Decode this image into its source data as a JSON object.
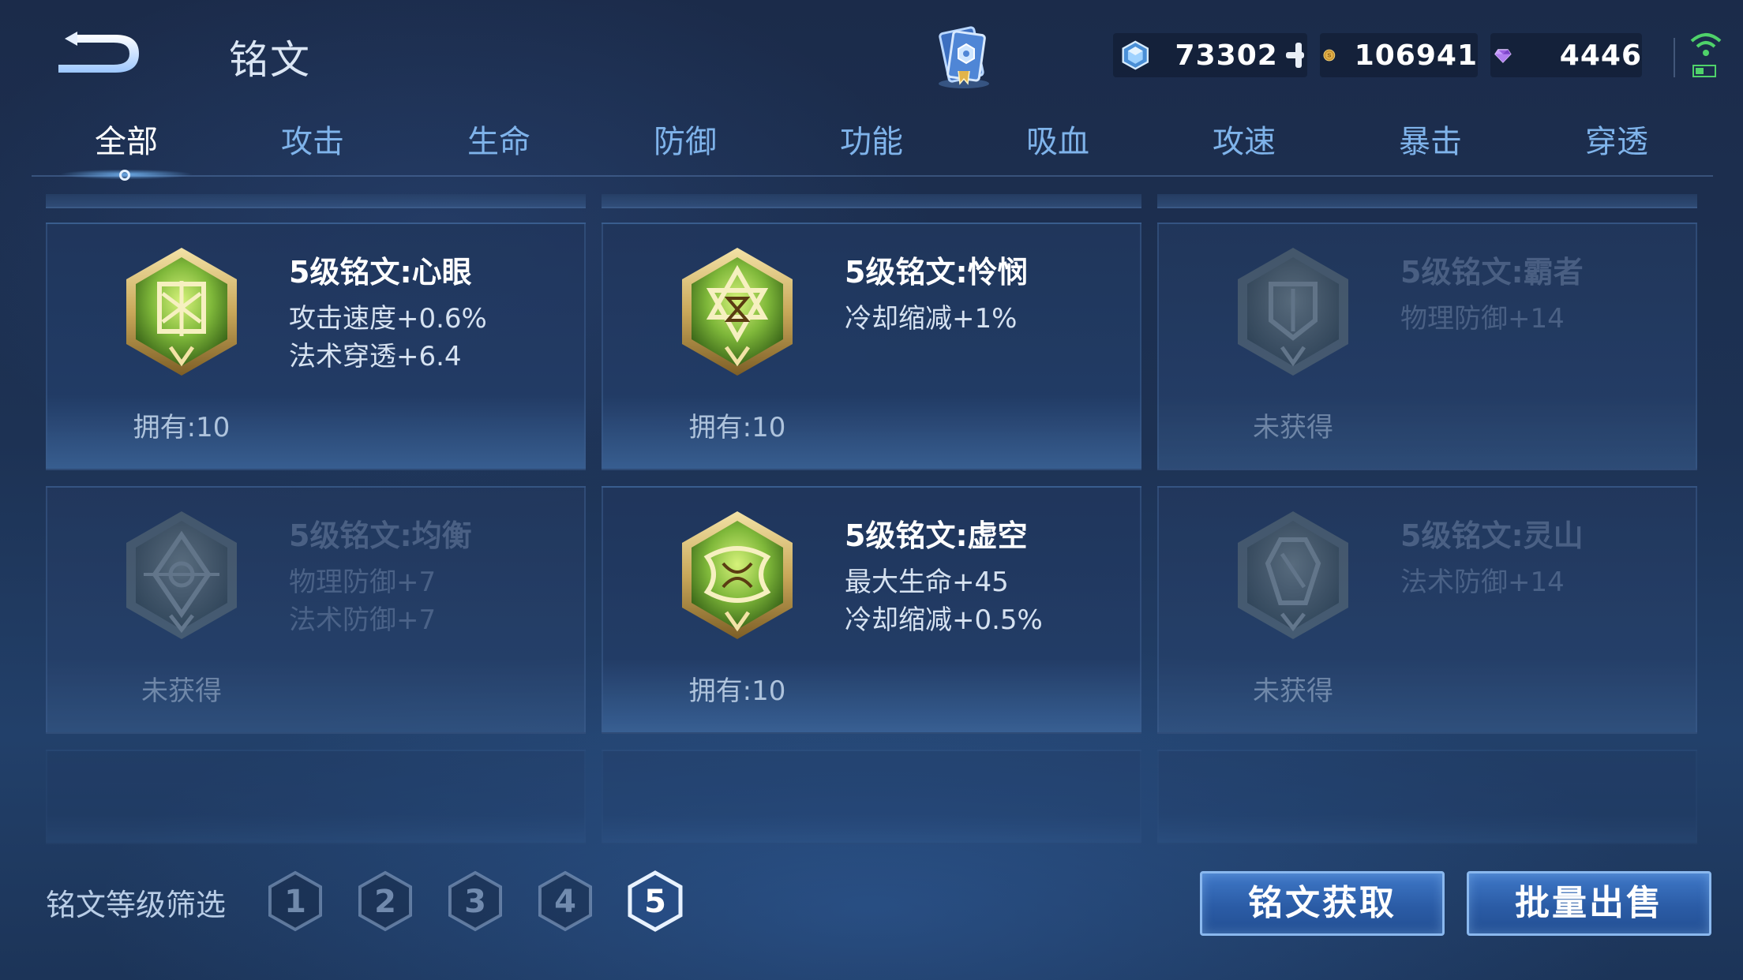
{
  "header": {
    "title": "铭文",
    "currencies": {
      "diamond": "73302",
      "gold": "106941",
      "gem": "4446"
    }
  },
  "tabs": [
    {
      "label": "全部"
    },
    {
      "label": "攻击"
    },
    {
      "label": "生命"
    },
    {
      "label": "防御"
    },
    {
      "label": "功能"
    },
    {
      "label": "吸血"
    },
    {
      "label": "攻速"
    },
    {
      "label": "暴击"
    },
    {
      "label": "穿透"
    }
  ],
  "cards": [
    {
      "name": "5级铭文:心眼",
      "stats": [
        "攻击速度+0.6%",
        "法术穿透+6.4"
      ],
      "status": "拥有:10",
      "owned": true
    },
    {
      "name": "5级铭文:怜悯",
      "stats": [
        "冷却缩减+1%",
        ""
      ],
      "status": "拥有:10",
      "owned": true
    },
    {
      "name": "5级铭文:霸者",
      "stats": [
        "物理防御+14",
        ""
      ],
      "status": "未获得",
      "owned": false
    },
    {
      "name": "5级铭文:均衡",
      "stats": [
        "物理防御+7",
        "法术防御+7"
      ],
      "status": "未获得",
      "owned": false
    },
    {
      "name": "5级铭文:虚空",
      "stats": [
        "最大生命+45",
        "冷却缩减+0.5%"
      ],
      "status": "拥有:10",
      "owned": true
    },
    {
      "name": "5级铭文:灵山",
      "stats": [
        "法术防御+14",
        ""
      ],
      "status": "未获得",
      "owned": false
    }
  ],
  "filter": {
    "label": "铭文等级筛选",
    "levels": [
      "1",
      "2",
      "3",
      "4",
      "5"
    ],
    "selected": "5"
  },
  "buttons": {
    "acquire": "铭文获取",
    "sell": "批量出售"
  },
  "colors": {
    "active_tab": "#ffffff",
    "tab_text": "#7fb3ea",
    "button_fill": "#2b5ca6",
    "rune_green": "#7fb83a",
    "rune_gold": "#c9a85a"
  }
}
